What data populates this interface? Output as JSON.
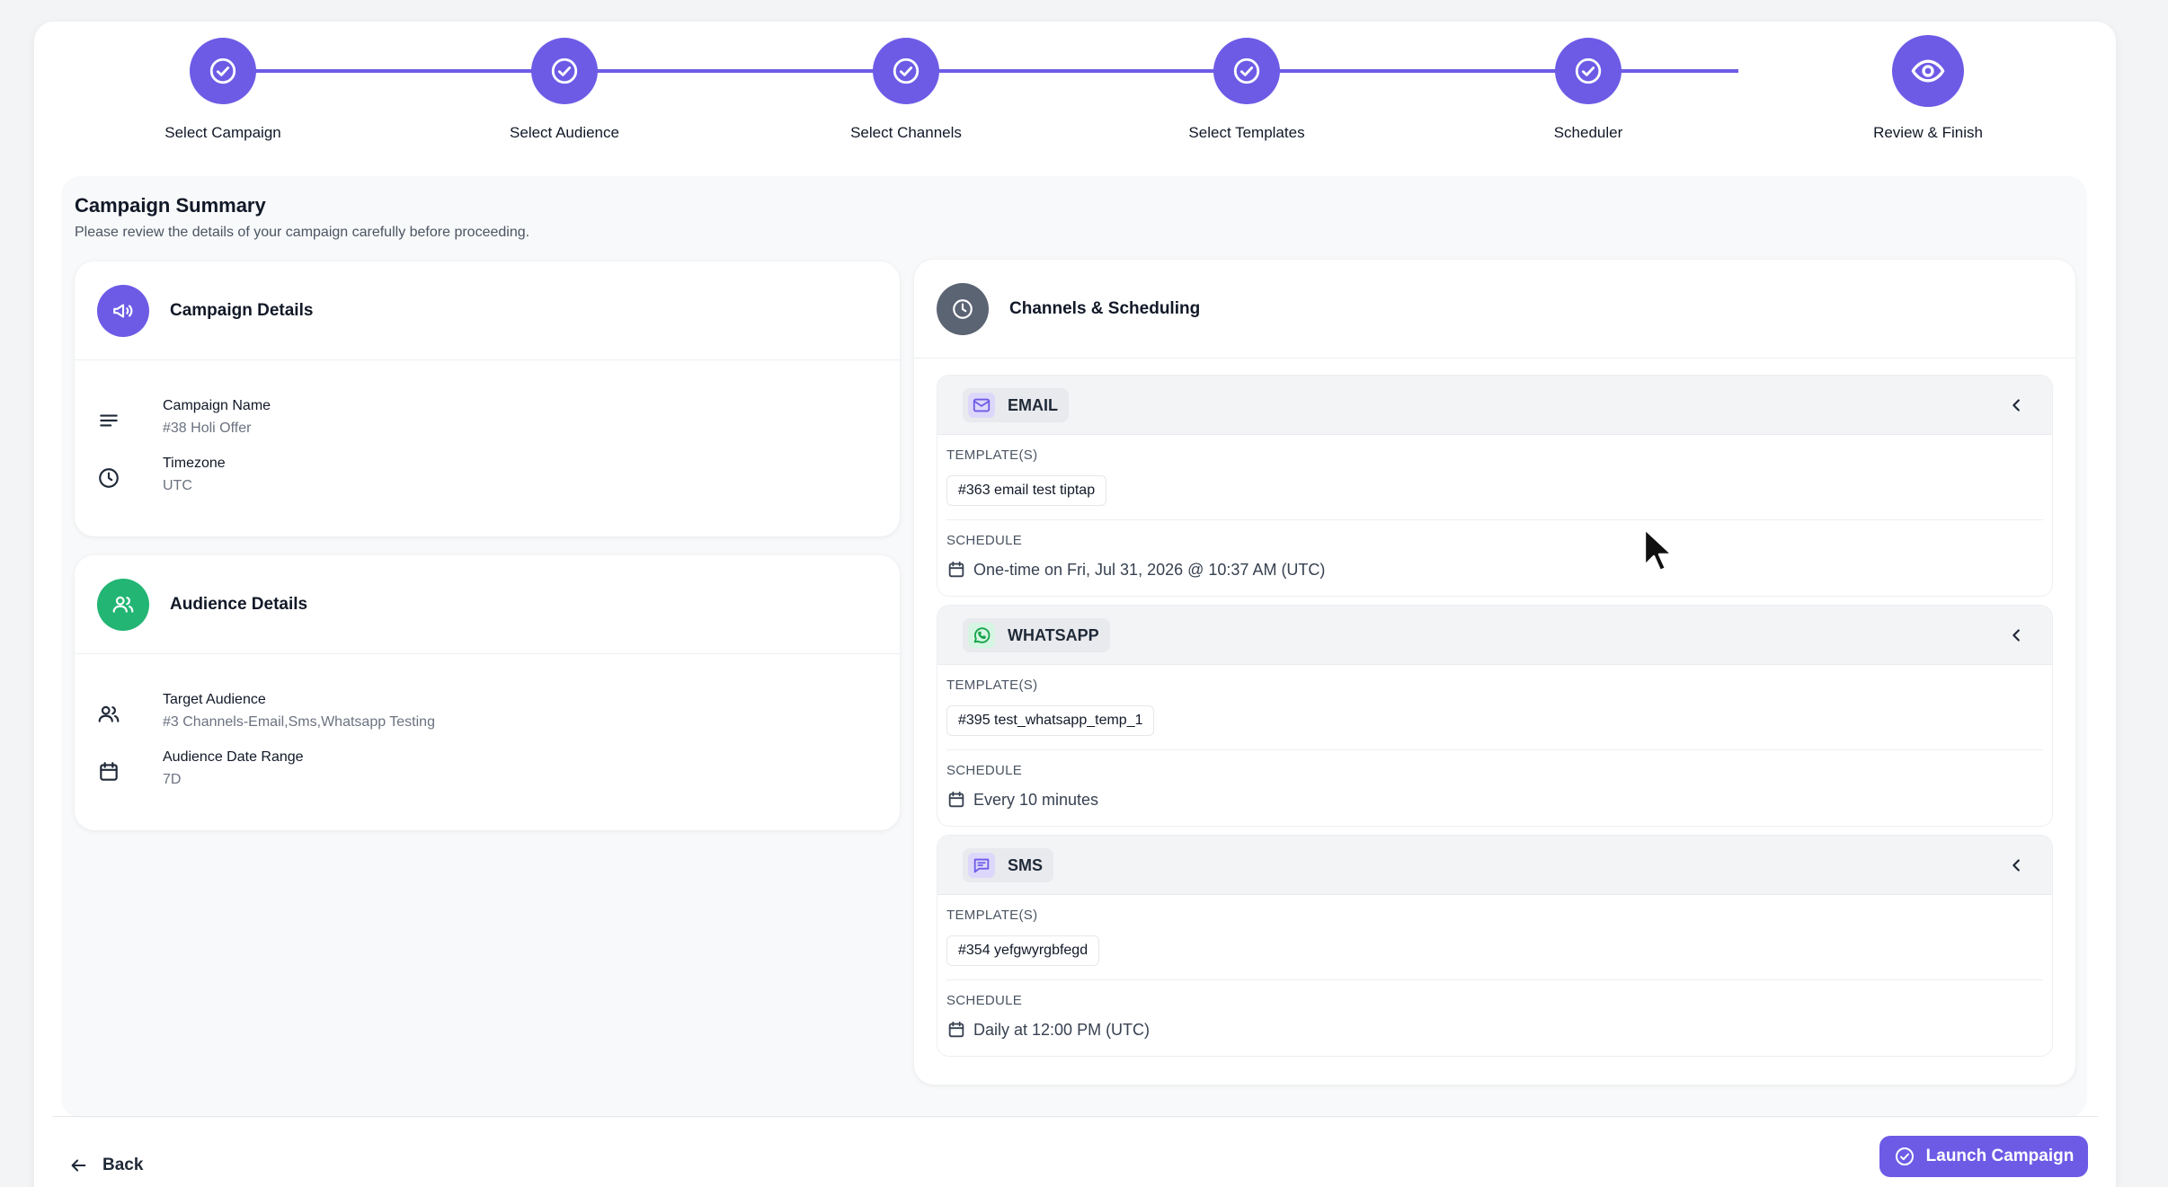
{
  "stepper": {
    "steps": [
      {
        "label": "Select Campaign",
        "status": "complete"
      },
      {
        "label": "Select Audience",
        "status": "complete"
      },
      {
        "label": "Select Channels",
        "status": "complete"
      },
      {
        "label": "Select Templates",
        "status": "complete"
      },
      {
        "label": "Scheduler",
        "status": "complete"
      },
      {
        "label": "Review & Finish",
        "status": "current"
      }
    ]
  },
  "summary": {
    "title": "Campaign Summary",
    "subtitle": "Please review the details of your campaign carefully before proceeding."
  },
  "campaign_details": {
    "title": "Campaign Details",
    "name_label": "Campaign Name",
    "name_value": "#38 Holi Offer",
    "timezone_label": "Timezone",
    "timezone_value": "UTC"
  },
  "audience_details": {
    "title": "Audience Details",
    "target_label": "Target Audience",
    "target_value": "#3 Channels-Email,Sms,Whatsapp Testing",
    "range_label": "Audience Date Range",
    "range_value": "7D"
  },
  "channels": {
    "title": "Channels & Scheduling",
    "template_label": "TEMPLATE(S)",
    "schedule_label": "SCHEDULE",
    "items": [
      {
        "name": "EMAIL",
        "template": "#363 email test tiptap",
        "schedule": "One-time on Fri, Jul 31, 2026 @ 10:37 AM (UTC)"
      },
      {
        "name": "WHATSAPP",
        "template": "#395 test_whatsapp_temp_1",
        "schedule": "Every 10 minutes"
      },
      {
        "name": "SMS",
        "template": "#354 yefgwyrgbfegd",
        "schedule": "Daily at 12:00 PM (UTC)"
      }
    ]
  },
  "footer": {
    "back_label": "Back",
    "launch_label": "Launch Campaign"
  },
  "colors": {
    "accent": "#6d5be6",
    "audience_green": "#22b573",
    "channels_gray": "#5b6473",
    "whatsapp_green": "#25d366"
  }
}
